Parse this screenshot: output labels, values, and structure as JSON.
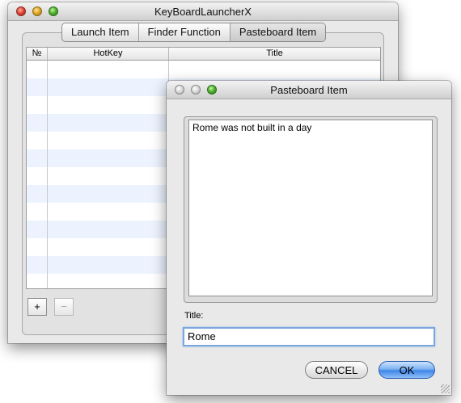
{
  "main_window": {
    "title": "KeyBoardLauncherX",
    "tabs": [
      {
        "label": "Launch Item",
        "selected": false
      },
      {
        "label": "Finder Function",
        "selected": false
      },
      {
        "label": "Pasteboard Item",
        "selected": true
      }
    ],
    "table": {
      "columns": [
        "№",
        "HotKey",
        "Title"
      ],
      "rows": []
    },
    "add_button": "+",
    "remove_button": "−"
  },
  "pasteboard_window": {
    "title": "Pasteboard Item",
    "content": "Rome was not built in a day",
    "title_label": "Title:",
    "title_value": "Rome",
    "cancel_label": "CANCEL",
    "ok_label": "OK"
  },
  "colors": {
    "accent": "#3d86e6",
    "row_stripe": "#edf3fe"
  }
}
